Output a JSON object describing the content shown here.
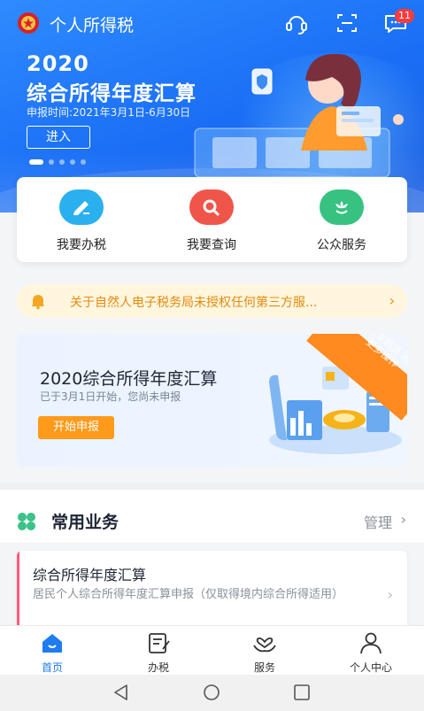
{
  "header": {
    "app_title": "个人所得税",
    "message_badge": "11"
  },
  "banner": {
    "year": "2020",
    "title": "综合所得年度汇算",
    "period": "申报时间:2021年3月1日-6月30日",
    "enter_label": "进入"
  },
  "quick_actions": [
    {
      "label": "我要办税",
      "icon": "pen-icon",
      "color": "#2ab0ef"
    },
    {
      "label": "我要查询",
      "icon": "search-icon",
      "color": "#f0554a"
    },
    {
      "label": "公众服务",
      "icon": "flower-icon",
      "color": "#38c281"
    }
  ],
  "notice": {
    "text": "关于自然人电子税务局未授权任何第三方服..."
  },
  "promo": {
    "title": "2020综合所得年度汇算",
    "subtitle": "已于3月1日开始，您尚未申报",
    "button": "开始申报",
    "ribbon": "进入专题页 进行更多操作"
  },
  "services": {
    "title": "常用业务",
    "manage": "管理",
    "items": [
      {
        "title": "综合所得年度汇算",
        "desc": "居民个人综合所得年度汇算申报（仅取得境内综合所得适用）"
      }
    ]
  },
  "tabs": [
    {
      "label": "首页",
      "icon": "home-icon",
      "active": true
    },
    {
      "label": "办税",
      "icon": "form-icon",
      "active": false
    },
    {
      "label": "服务",
      "icon": "heart-hands-icon",
      "active": false
    },
    {
      "label": "个人中心",
      "icon": "person-icon",
      "active": false
    }
  ],
  "colors": {
    "brand_blue": "#1f7cf0",
    "notice_text": "#e48a10",
    "promo_button": "#ff9a1a"
  }
}
